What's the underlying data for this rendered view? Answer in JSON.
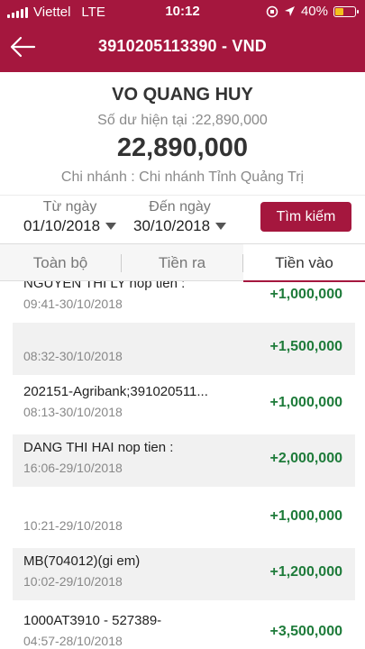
{
  "status_bar": {
    "carrier": "Viettel",
    "network": "LTE",
    "time": "10:12",
    "battery": "40%",
    "battery_level": 0.4
  },
  "nav": {
    "title": "3910205113390 - VND"
  },
  "account": {
    "name": "VO QUANG HUY",
    "balance_line": "Số dư hiện tại :22,890,000",
    "balance": "22,890,000",
    "branch": "Chi nhánh : Chi nhánh Tỉnh Quảng Trị"
  },
  "filter": {
    "from_label": "Từ ngày",
    "from_value": "01/10/2018",
    "to_label": "Đến ngày",
    "to_value": "30/10/2018",
    "search_label": "Tìm kiếm"
  },
  "tabs": [
    {
      "label": "Toàn bộ"
    },
    {
      "label": "Tiền ra"
    },
    {
      "label": "Tiền vào"
    }
  ],
  "transactions": [
    {
      "description": "NGUYEN THI LY nop tien :",
      "time": "09:41-30/10/2018",
      "amount": "+1,000,000"
    },
    {
      "description": "",
      "time": "08:32-30/10/2018",
      "amount": "+1,500,000"
    },
    {
      "description": "202151-Agribank;391020511...",
      "time": "08:13-30/10/2018",
      "amount": "+1,000,000"
    },
    {
      "description": "DANG THI HAI nop tien :",
      "time": "16:06-29/10/2018",
      "amount": "+2,000,000"
    },
    {
      "description": "",
      "time": "10:21-29/10/2018",
      "amount": "+1,000,000"
    },
    {
      "description": "MB(704012)(gi em)",
      "time": "10:02-29/10/2018",
      "amount": "+1,200,000"
    },
    {
      "description": "1000AT3910 - 527389-",
      "time": "04:57-28/10/2018",
      "amount": "+3,500,000"
    }
  ]
}
